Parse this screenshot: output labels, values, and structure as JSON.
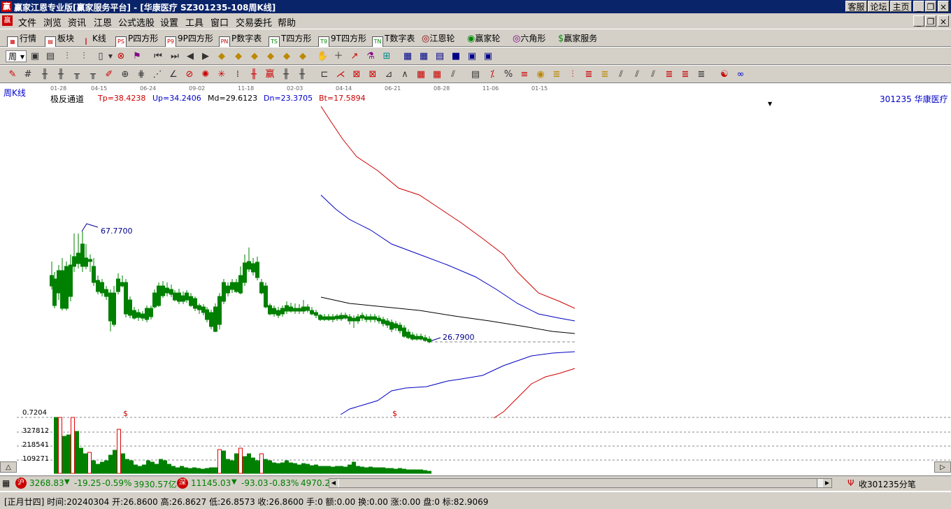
{
  "window": {
    "title": "赢家江恩专业版[赢家服务平台] - [华康医疗  SZ301235-108周K线]",
    "links": [
      "客服",
      "论坛",
      "主页"
    ]
  },
  "menu": [
    "文件",
    "浏览",
    "资讯",
    "江恩",
    "公式选股",
    "设置",
    "工具",
    "窗口",
    "交易委托",
    "帮助"
  ],
  "toolbar1": [
    {
      "label": "行情",
      "icon": "grid-icon"
    },
    {
      "label": "板块",
      "icon": "blocks-icon"
    },
    {
      "label": "K线",
      "icon": "candlestick-icon"
    },
    {
      "label": "P四方形",
      "icon": "ps-icon",
      "badge": "PS"
    },
    {
      "label": "9P四方形",
      "icon": "p9-icon",
      "badge": "P9"
    },
    {
      "label": "P数字表",
      "icon": "pn-icon",
      "badge": "PN"
    },
    {
      "label": "T四方形",
      "icon": "ts-icon",
      "badge": "TS"
    },
    {
      "label": "9T四方形",
      "icon": "t9-icon",
      "badge": "T9"
    },
    {
      "label": "T数字表",
      "icon": "tn-icon",
      "badge": "TN"
    },
    {
      "label": "江恩轮",
      "icon": "gann-wheel-icon"
    },
    {
      "label": "赢家轮",
      "icon": "winner-wheel-icon"
    },
    {
      "label": "六角形",
      "icon": "hexagon-icon"
    },
    {
      "label": "赢家服务",
      "icon": "dollar-icon"
    }
  ],
  "toolbar2": {
    "period_label": "周"
  },
  "chart": {
    "period": "周K线",
    "indicator_name": "极反通道",
    "tp": "Tp=38.4238",
    "up": "Up=34.2406",
    "md": "Md=29.6123",
    "dn": "Dn=23.3705",
    "bt": "Bt=17.5894",
    "stock_label": "301235 华康医疗",
    "high_label": "67.7700",
    "last_label": "26.7900",
    "top_dates": [
      "01-28",
      "04-15",
      "06-24",
      "09-02",
      "11-18",
      "02-03",
      "04-14",
      "06-21",
      "08-28",
      "11-06",
      "01-15"
    ],
    "vol_labels": [
      "0.7204",
      "327812",
      "218541",
      "109271"
    ],
    "dollar_marks": [
      "$",
      "$"
    ]
  },
  "status1": {
    "sh_icon": "沪",
    "sh_index": "3268.83",
    "sh_change": "-19.25",
    "sh_pct": "-0.59%",
    "sh_amount": "3930.57亿",
    "sz_icon": "深",
    "sz_index": "11145.03",
    "sz_change": "-93.03",
    "sz_pct": "-0.83%",
    "sz_amount": "4970.2",
    "right_text": "收301235分笔"
  },
  "status2": {
    "text": "[正月廿四] 时间:20240304 开:26.8600 高:26.8627 低:26.8573 收:26.8600 手:0 额:0.00 换:0.00 涨:0.00 盘:0 标:82.9069"
  },
  "colors": {
    "up": "#e00000",
    "down": "#008000",
    "channel_outer": "#d00000",
    "channel_inner": "#0000c0",
    "middle": "#000000"
  }
}
